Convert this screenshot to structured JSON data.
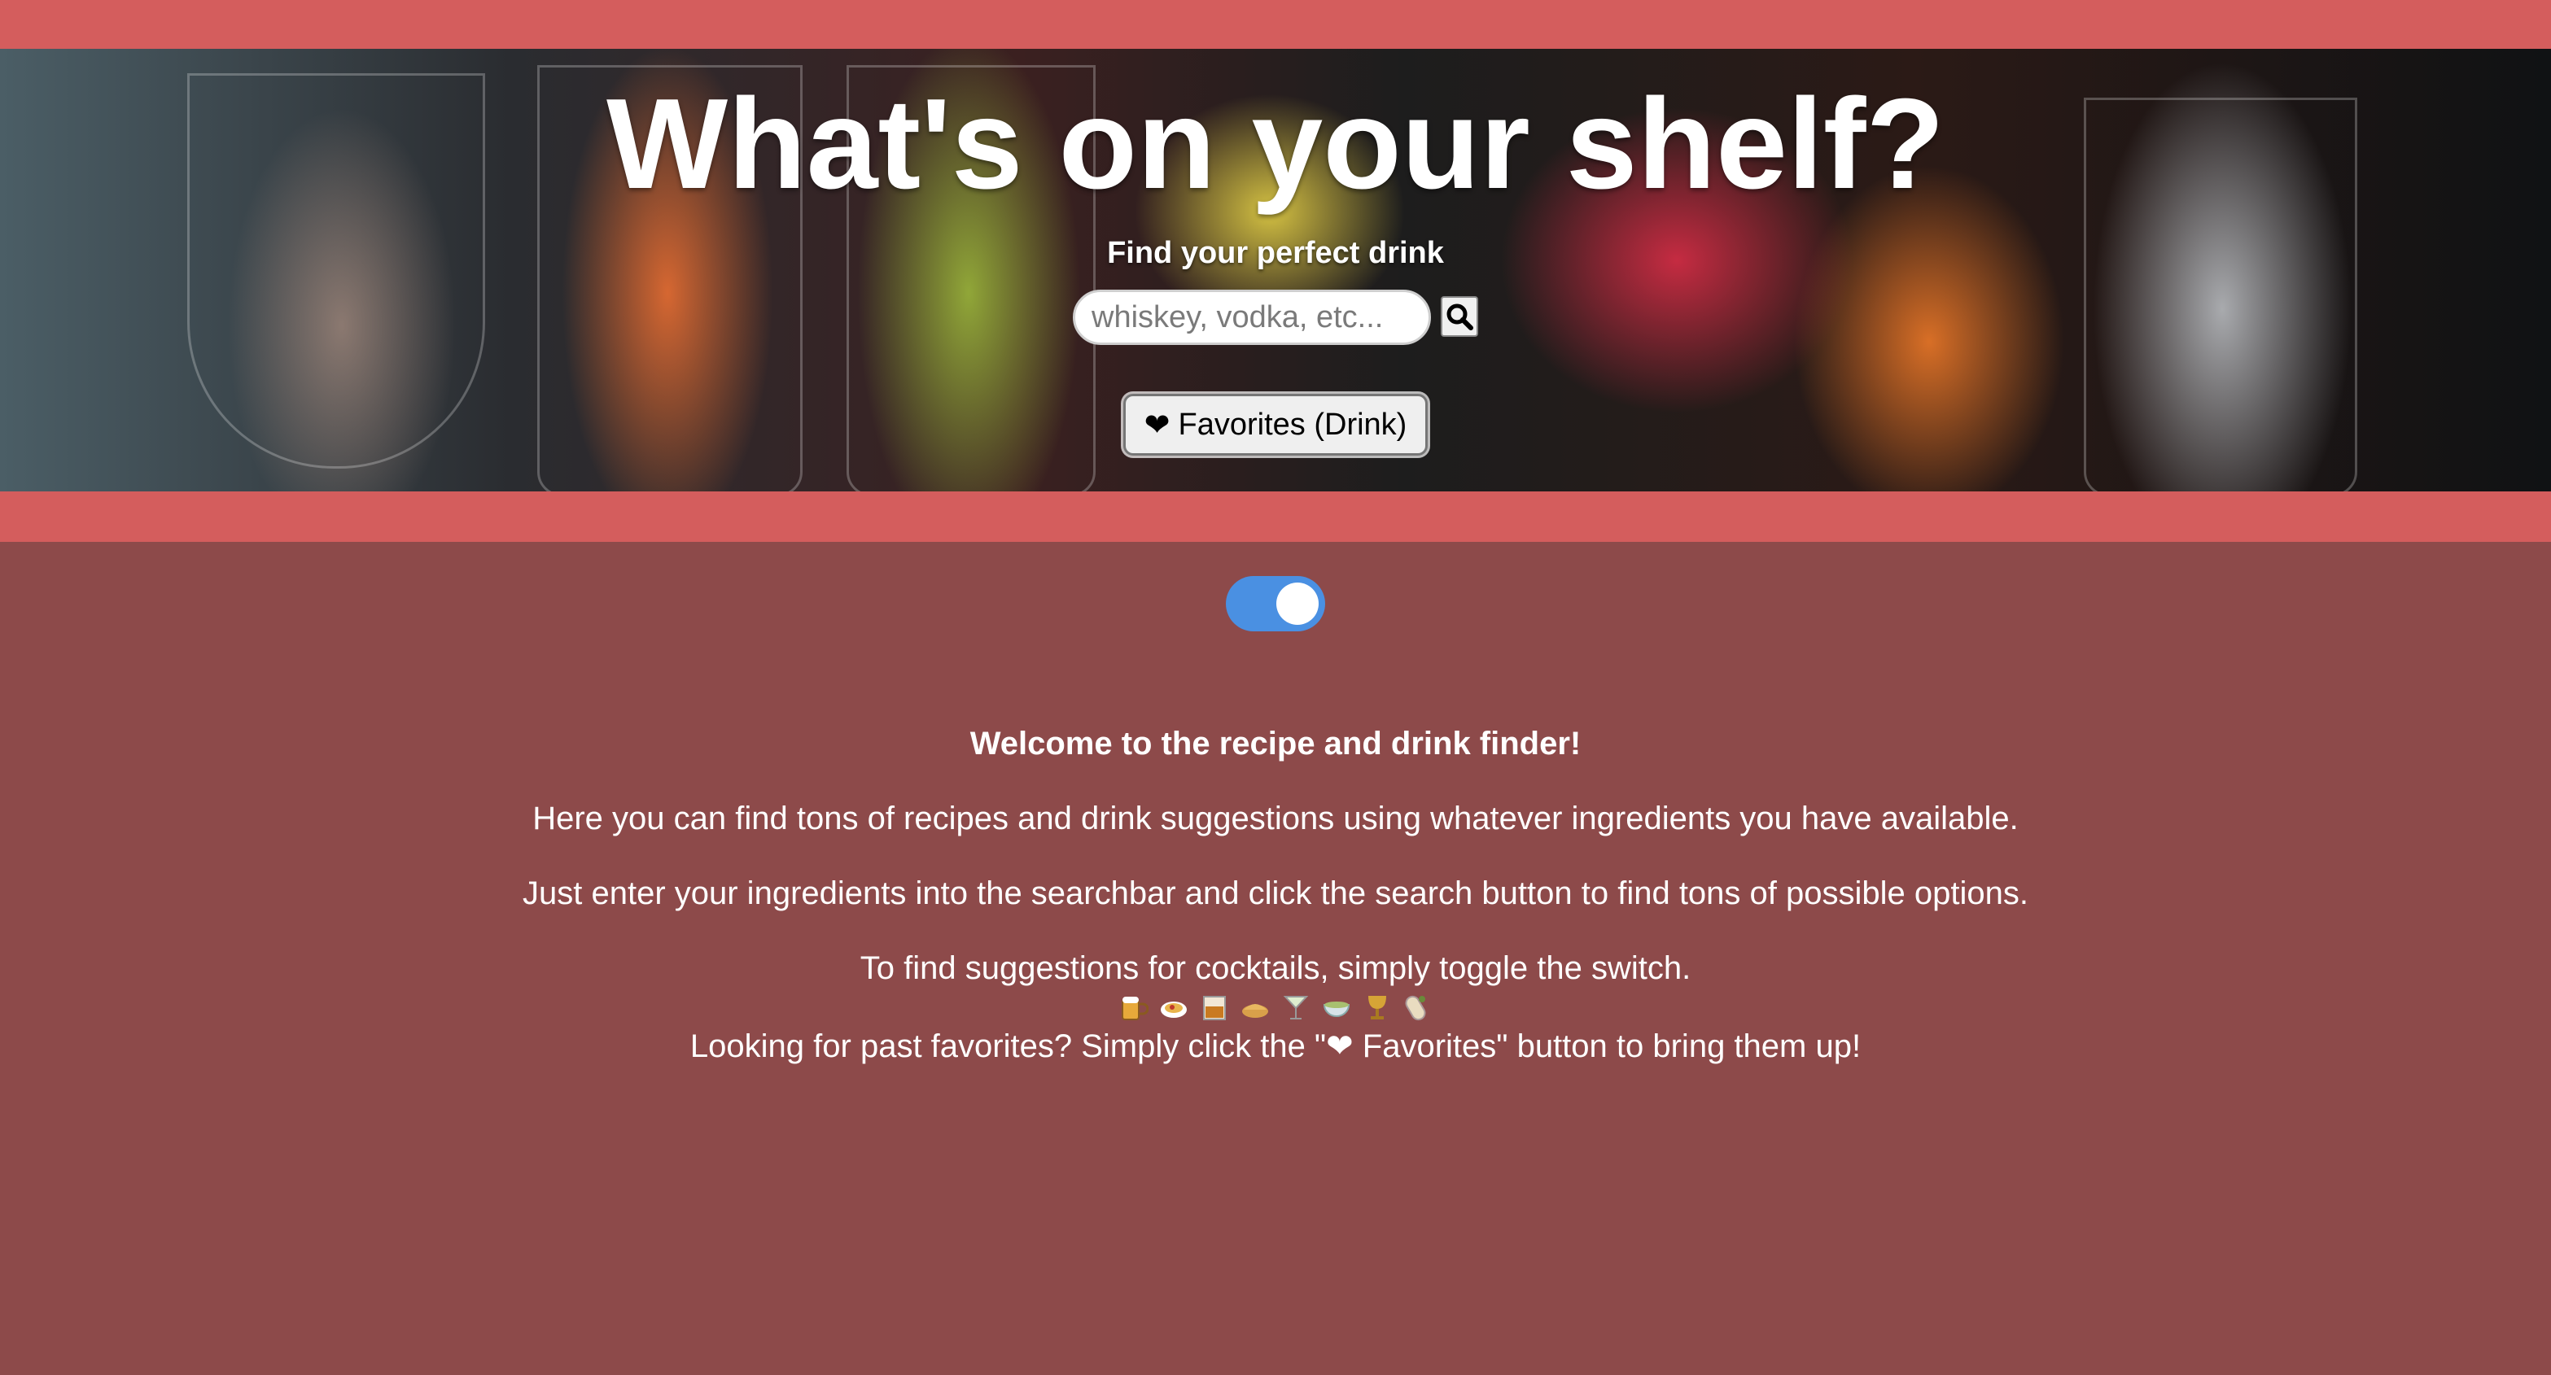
{
  "header": {
    "title": "What's on your shelf?",
    "subtitle": "Find your perfect drink"
  },
  "search": {
    "placeholder": "whiskey, vodka, etc...",
    "button_icon": "search-icon"
  },
  "favorites_button": {
    "icon": "heart-icon",
    "label": "Favorites (Drink)"
  },
  "toggle": {
    "state": "on",
    "accent": "#4a90e2"
  },
  "content": {
    "welcome": "Welcome to the recipe and drink finder!",
    "line1": "Here you can find tons of recipes and drink suggestions using whatever ingredients you have available.",
    "line2": "Just enter your ingredients into the searchbar and click the search button to find tons of possible options.",
    "line3": "To find suggestions for cocktails, simply toggle the switch.",
    "emoji_icons": [
      "beer-mug-icon",
      "spaghetti-icon",
      "tumbler-glass-icon",
      "pie-icon",
      "cocktail-glass-icon",
      "bowl-icon",
      "goblet-icon",
      "burrito-icon"
    ],
    "line4": "Looking for past favorites? Simply click the \"❤ Favorites\" button to bring them up!"
  },
  "colors": {
    "band": "#d45d5d",
    "background": "#8d4a4a"
  }
}
